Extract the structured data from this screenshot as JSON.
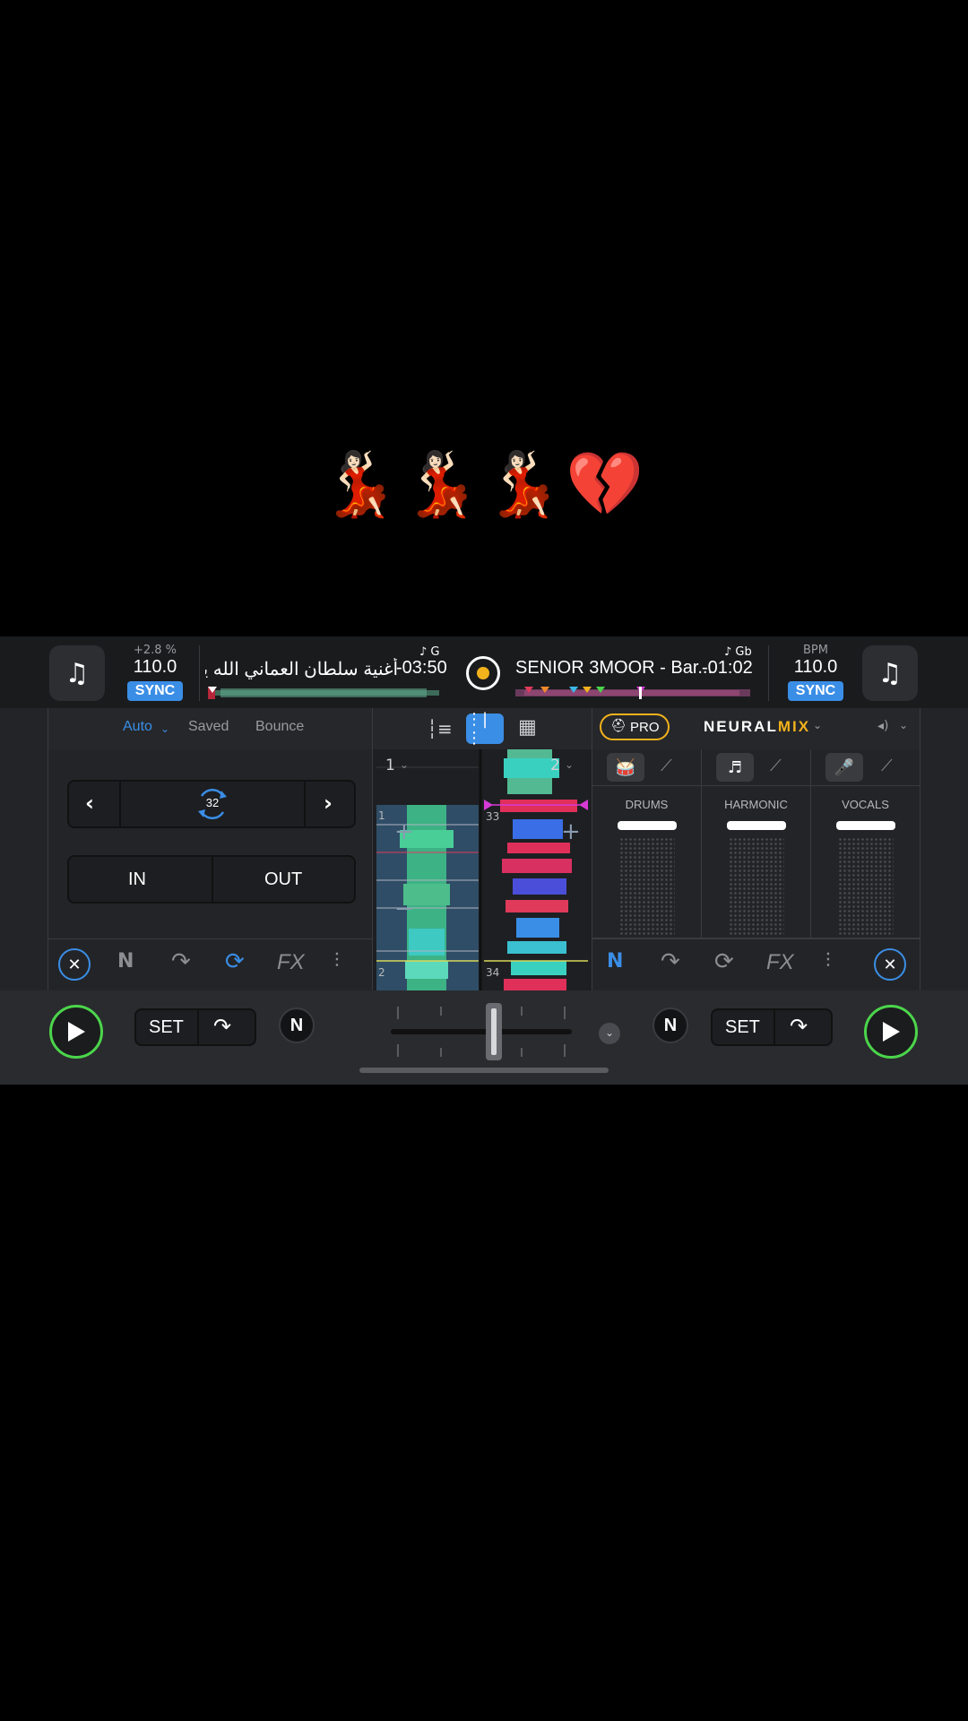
{
  "overlay": {
    "emoji": "💃🏻💃🏻💃🏻💔"
  },
  "deck_left": {
    "library_icon": "music-note-icon",
    "pitch": "+2.8 %",
    "bpm": "110.0",
    "sync": "SYNC",
    "title": "أغنية سلطان العماني الله يو...",
    "time": "-03:50",
    "key": "♪ G"
  },
  "deck_right": {
    "library_icon": "music-note-icon",
    "bpm_label": "BPM",
    "bpm": "110.0",
    "sync": "SYNC",
    "title": "SENIOR 3MOOR - Bar...",
    "time": "-01:02",
    "key": "♪ Gb"
  },
  "loop_panel": {
    "tabs": [
      "Auto",
      "Saved",
      "Bounce"
    ],
    "loop_size": "32",
    "in_label": "IN",
    "out_label": "OUT"
  },
  "waveform": {
    "deck1_label": "1",
    "deck2_label": "2",
    "bar_left_top": "1",
    "bar_left_bottom": "2",
    "bar_right_top": "33",
    "bar_right_bottom": "34"
  },
  "neural_mix": {
    "pro_label": "PRO",
    "title_a": "NEURAL",
    "title_b": "MIX",
    "stems": [
      "DRUMS",
      "HARMONIC",
      "VOCALS"
    ],
    "accent": "#f2b21c"
  },
  "transport_left": {
    "set_label": "SET"
  },
  "transport_right": {
    "set_label": "SET"
  },
  "colors": {
    "play_ring": "#4bd54b",
    "sync": "#3a8ee6",
    "active_blue": "#3a8ee6"
  }
}
